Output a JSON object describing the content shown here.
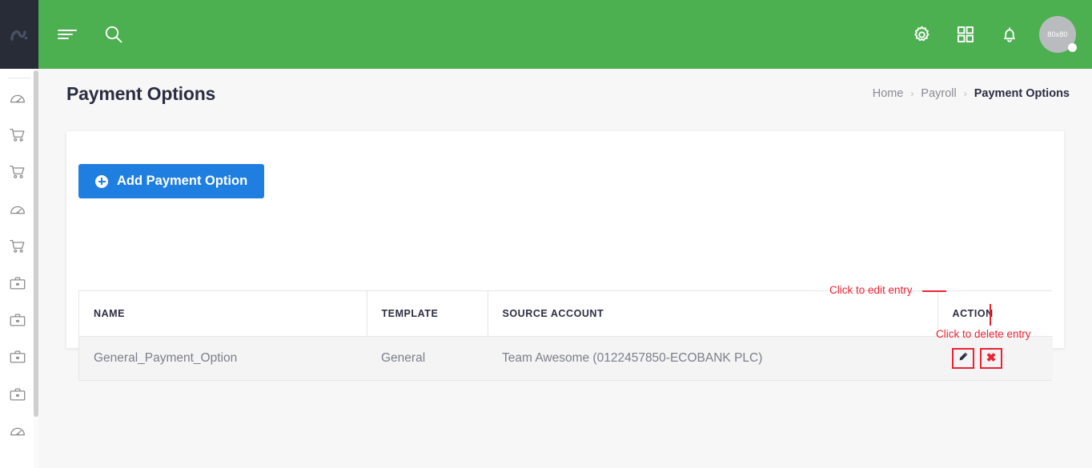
{
  "brand": {
    "logo_name": "app-logo-mark"
  },
  "topbar": {
    "menu_icon": "hamburger-menu-icon",
    "search_icon": "search-icon",
    "settings_icon": "gear-icon",
    "apps_icon": "grid-apps-icon",
    "notifications_icon": "bell-icon",
    "avatar_label": "80x80"
  },
  "sidebar": {
    "items": [
      {
        "icon": "speedometer-icon",
        "name": "sidebar-item-dashboard"
      },
      {
        "icon": "cart-icon",
        "name": "sidebar-item-cart-1"
      },
      {
        "icon": "cart-icon",
        "name": "sidebar-item-cart-2"
      },
      {
        "icon": "speedometer-icon",
        "name": "sidebar-item-dashboard-2"
      },
      {
        "icon": "cart-icon",
        "name": "sidebar-item-cart-3"
      },
      {
        "icon": "briefcase-icon",
        "name": "sidebar-item-briefcase-1"
      },
      {
        "icon": "briefcase-icon",
        "name": "sidebar-item-briefcase-2"
      },
      {
        "icon": "briefcase-icon",
        "name": "sidebar-item-briefcase-3"
      },
      {
        "icon": "briefcase-icon",
        "name": "sidebar-item-briefcase-4"
      },
      {
        "icon": "speedometer-icon",
        "name": "sidebar-item-dashboard-3"
      }
    ]
  },
  "page": {
    "title": "Payment Options",
    "breadcrumb": [
      {
        "label": "Home",
        "current": false
      },
      {
        "label": "Payroll",
        "current": false
      },
      {
        "label": "Payment Options",
        "current": true
      }
    ],
    "breadcrumb_separator": "›"
  },
  "toolbar": {
    "add_label": "Add Payment Option",
    "add_icon": "circle-plus-icon"
  },
  "table": {
    "columns": [
      "NAME",
      "TEMPLATE",
      "SOURCE ACCOUNT",
      "ACTION"
    ],
    "rows": [
      {
        "name": "General_Payment_Option",
        "template": "General",
        "source_account": "Team Awesome (0122457850-ECOBANK PLC)",
        "edit_icon": "pencil-icon",
        "delete_icon": "cross-icon"
      }
    ]
  },
  "annotations": {
    "edit": "Click to edit entry",
    "delete": "Click to delete entry",
    "color": "#ee2233"
  },
  "colors": {
    "header_green": "#4caf50",
    "primary_blue": "#1f7fe0",
    "sidebar_dark": "#282c37",
    "page_bg": "#f7f7f7",
    "row_bg": "#f4f4f4"
  }
}
